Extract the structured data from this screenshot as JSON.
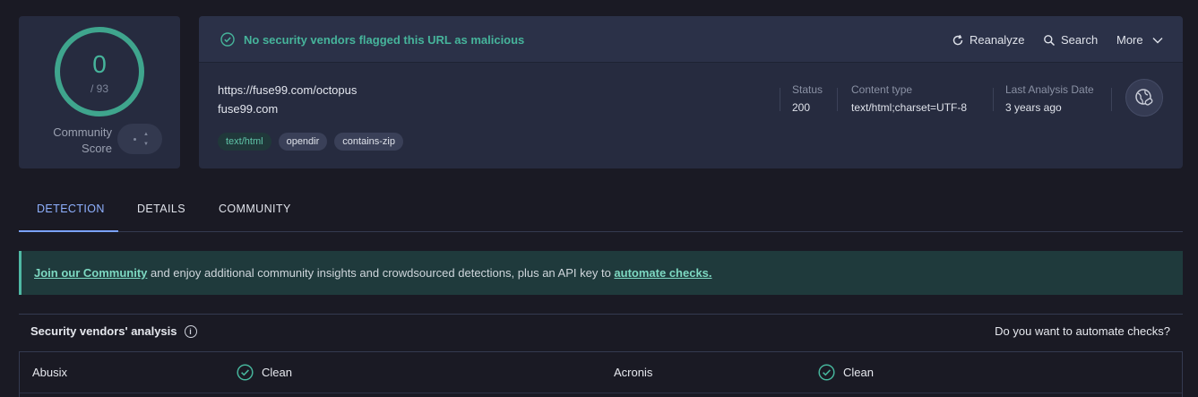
{
  "community_score": {
    "detections": "0",
    "total": "/ 93",
    "label": "Community Score"
  },
  "header": {
    "verdict": "No security vendors flagged this URL as malicious",
    "reanalyze_label": "Reanalyze",
    "search_label": "Search",
    "more_label": "More"
  },
  "target": {
    "url": "https://fuse99.com/octopus",
    "domain": "fuse99.com",
    "tags": [
      "text/html",
      "opendir",
      "contains-zip"
    ]
  },
  "meta": {
    "status_label": "Status",
    "status_value": "200",
    "content_type_label": "Content type",
    "content_type_value": "text/html;charset=UTF-8",
    "last_analysis_label": "Last Analysis Date",
    "last_analysis_value": "3 years ago"
  },
  "tabs": [
    "DETECTION",
    "DETAILS",
    "COMMUNITY"
  ],
  "banner": {
    "join_link": "Join our Community",
    "middle_text": " and enjoy additional community insights and crowdsourced detections, plus an API key to ",
    "automate_link": "automate checks."
  },
  "vendors_section": {
    "title": "Security vendors' analysis",
    "automate_question": "Do you want to automate checks?"
  },
  "vendors": [
    {
      "name": "Abusix",
      "result": "Clean"
    },
    {
      "name": "Acronis",
      "result": "Clean"
    }
  ],
  "colors": {
    "clean_green": "#46b49b",
    "accent_blue": "#7aa2ff",
    "background": "#1a1a24",
    "card": "#262b3f"
  }
}
